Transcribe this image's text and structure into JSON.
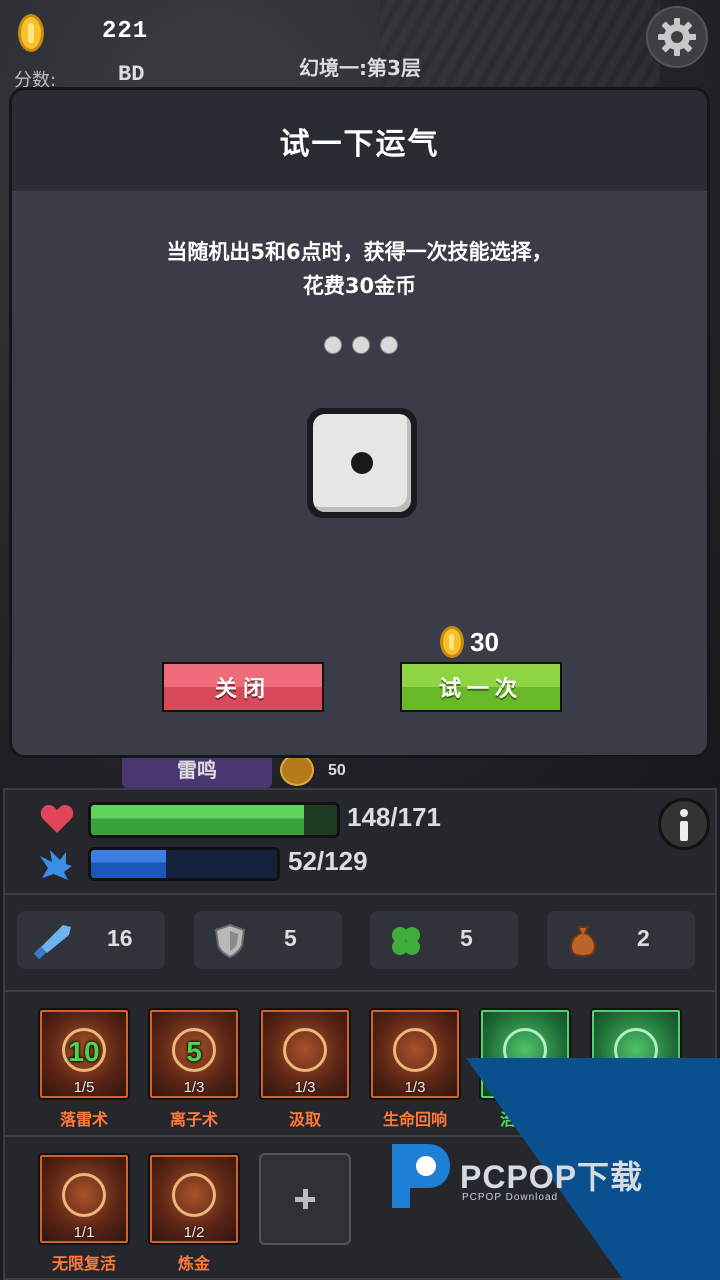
{
  "hud": {
    "gold": "221",
    "score_label": "分数:",
    "score_value": "BD",
    "floor": "幻境一:第3层"
  },
  "enemy": {
    "name": "雷鸣",
    "count": "50"
  },
  "dialog": {
    "title": "试一下运气",
    "description_line1": "当随机出5和6点时，获得一次技能选择，",
    "description_line2": "花费30金币",
    "die_value": 1,
    "cost": "30",
    "close_label": "关闭",
    "try_label": "试一次"
  },
  "player": {
    "hp_text": "148/171",
    "hp_fraction": 0.865,
    "mp_text": "52/129",
    "mp_fraction": 0.403
  },
  "stats": [
    {
      "icon": "sword-icon",
      "value": "16"
    },
    {
      "icon": "shield-icon",
      "value": "5"
    },
    {
      "icon": "clover-icon",
      "value": "5"
    },
    {
      "icon": "money-bag-icon",
      "value": "2"
    }
  ],
  "skills": [
    {
      "name": "落雷术",
      "level": "10",
      "progress": "1/5",
      "theme": "fire"
    },
    {
      "name": "离子术",
      "level": "5",
      "progress": "1/3",
      "theme": "fire"
    },
    {
      "name": "汲取",
      "level": "",
      "progress": "1/3",
      "theme": "fire"
    },
    {
      "name": "生命回响",
      "level": "",
      "progress": "1/3",
      "theme": "fire"
    },
    {
      "name": "治",
      "level": "",
      "progress": "",
      "theme": "green"
    },
    {
      "name": "",
      "level": "",
      "progress": "",
      "theme": "green"
    },
    {
      "name": "无限复活",
      "level": "",
      "progress": "1/1",
      "theme": "fire"
    },
    {
      "name": "炼金",
      "level": "",
      "progress": "1/2",
      "theme": "fire"
    }
  ],
  "watermark": {
    "brand": "PCPOP下载",
    "sub": "PCPOP Download"
  },
  "colors": {
    "hp": "#3aa23c",
    "mp": "#1e56b8",
    "close_button": "#d8495a",
    "try_button": "#68b82a",
    "skill_label": "#ff7a3a"
  }
}
